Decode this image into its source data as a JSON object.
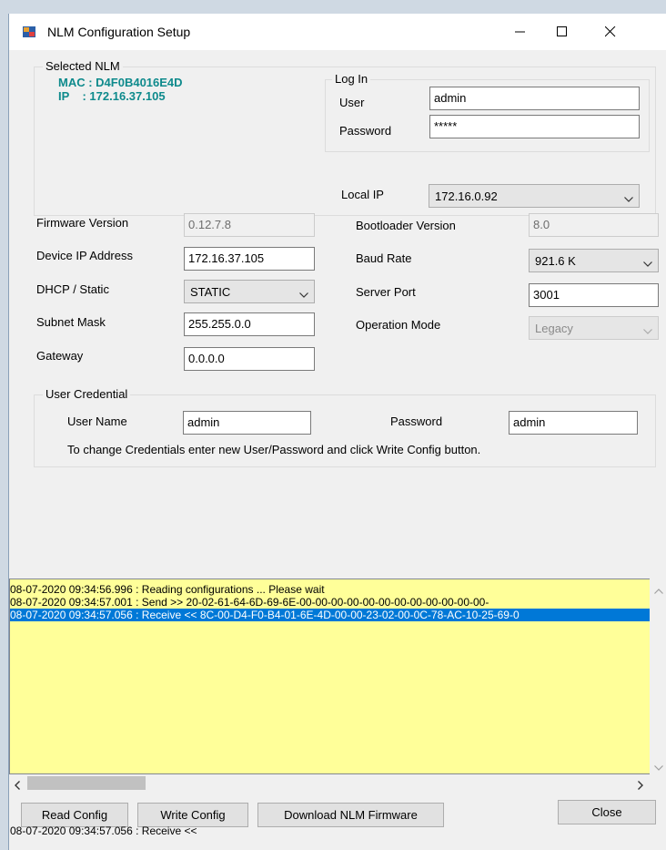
{
  "window": {
    "title": "NLM Configuration Setup"
  },
  "selected_nlm": {
    "legend": "Selected NLM",
    "mac": "MAC : D4F0B4016E4D",
    "ip": "IP    : 172.16.37.105"
  },
  "login": {
    "legend": "Log In",
    "user_label": "User",
    "user_value": "admin",
    "password_label": "Password",
    "password_value": "*****",
    "local_ip_label": "Local IP",
    "local_ip_value": "172.16.0.92"
  },
  "config": {
    "firmware_label": "Firmware Version",
    "firmware_value": "0.12.7.8",
    "device_ip_label": "Device IP Address",
    "device_ip_value": "172.16.37.105",
    "dhcp_label": "DHCP / Static",
    "dhcp_value": "STATIC",
    "subnet_label": "Subnet Mask",
    "subnet_value": "255.255.0.0",
    "gateway_label": "Gateway",
    "gateway_value": "0.0.0.0",
    "bootloader_label": "Bootloader Version",
    "bootloader_value": "8.0",
    "baud_label": "Baud Rate",
    "baud_value": "921.6 K",
    "server_port_label": "Server Port",
    "server_port_value": "3001",
    "op_mode_label": "Operation Mode",
    "op_mode_value": "Legacy"
  },
  "credentials": {
    "legend": "User Credential",
    "username_label": "User Name",
    "username_value": "admin",
    "password_label": "Password",
    "password_value": "admin",
    "hint": "To change Credentials enter new User/Password and click Write Config button."
  },
  "log": {
    "lines": [
      "08-07-2020 09:34:56.996  : Reading configurations ... Please wait",
      "08-07-2020 09:34:57.001  : Send >> 20-02-61-64-6D-69-6E-00-00-00-00-00-00-00-00-00-00-00-00-",
      "08-07-2020 09:34:57.056  : Receive << 8C-00-D4-F0-B4-01-6E-4D-00-00-23-02-00-0C-78-AC-10-25-69-0"
    ]
  },
  "buttons": {
    "read": "Read Config",
    "write": "Write Config",
    "download": "Download NLM Firmware",
    "close": "Close"
  },
  "status_text": "08-07-2020 09:34:57.056  : Receive <<"
}
